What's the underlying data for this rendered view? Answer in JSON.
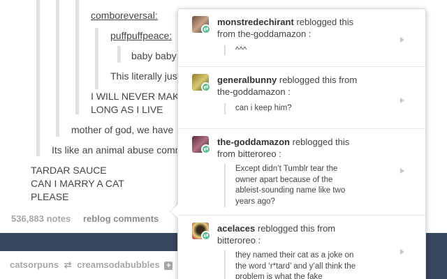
{
  "thread": {
    "user1": "comboreversal",
    "user2": "puffpuffpeace",
    "line_baby": "baby baby",
    "line_literally": "This literally jus",
    "line_never1": "I WILL NEVER MAK",
    "line_never2": "LONG AS I LIVE",
    "line_mother": "mother of god, we have",
    "line_animal": "Its like an animal abuse comm",
    "line_tardar1": "TARDAR SAUCE",
    "line_tardar2": "CAN I MARRY A CAT",
    "line_tardar3": "PLEASE"
  },
  "post_footer": {
    "notes": "536,883 notes",
    "reblog_comments": "reblog comments"
  },
  "reblog_trail": {
    "from": "catsorpuns",
    "to": "creamsodabubbles",
    "plus": "+"
  },
  "notes": [
    {
      "user": "monstredechirant",
      "action": "reblogged this from",
      "source": "the-goddamazon :",
      "comment": "^^^"
    },
    {
      "user": "generalbunny",
      "action": "reblogged this from",
      "source": "the-goddamazon :",
      "comment": "can i keep him?"
    },
    {
      "user": "the-goddamazon",
      "action": "reblogged this from",
      "source": "bitteroreo :",
      "comment": "Except didn’t Tumblr tear the owner apart because of the ableist-sounding name like two years ago?"
    },
    {
      "user": "acelaces",
      "action": "reblogged this from",
      "source": "bitteroreo :",
      "comment": "they named their cat as a joke on the word ‘r*tard’ and y’all think the problem is what the fake"
    }
  ],
  "colors": {
    "background": "#36465d",
    "reblog_badge": "#56bc8a"
  }
}
